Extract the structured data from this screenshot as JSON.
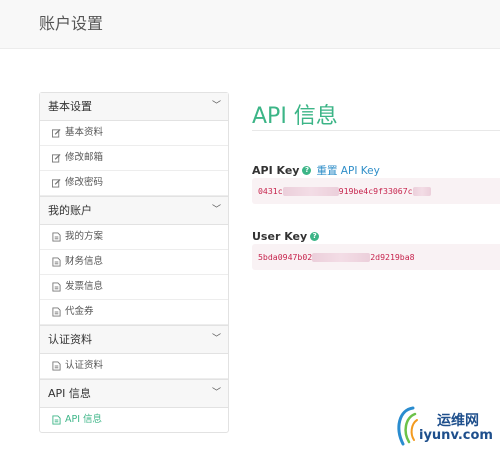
{
  "header": {
    "title": "账户设置"
  },
  "sidebar": {
    "groups": [
      {
        "title": "基本设置",
        "items": [
          {
            "label": "基本资料"
          },
          {
            "label": "修改邮箱"
          },
          {
            "label": "修改密码"
          }
        ]
      },
      {
        "title": "我的账户",
        "items": [
          {
            "label": "我的方案"
          },
          {
            "label": "财务信息"
          },
          {
            "label": "发票信息"
          },
          {
            "label": "代金券"
          }
        ]
      },
      {
        "title": "认证资料",
        "items": [
          {
            "label": "认证资料"
          }
        ]
      },
      {
        "title": "API 信息",
        "items": [
          {
            "label": "API 信息"
          }
        ]
      }
    ]
  },
  "main": {
    "title": "API 信息",
    "api_key": {
      "label": "API Key",
      "reset_link": "重置 API Key",
      "value_prefix": "0431c",
      "value_suffix": "919be4c9f33067c"
    },
    "user_key": {
      "label": "User Key",
      "value_prefix": "5bda0947b02",
      "value_suffix": "2d9219ba8"
    }
  },
  "watermark": {
    "text_cn": "运维网",
    "url": "iyunv.com"
  },
  "colors": {
    "accent": "#3cb587",
    "link": "#2f8ec8",
    "code": "#c7254e"
  }
}
